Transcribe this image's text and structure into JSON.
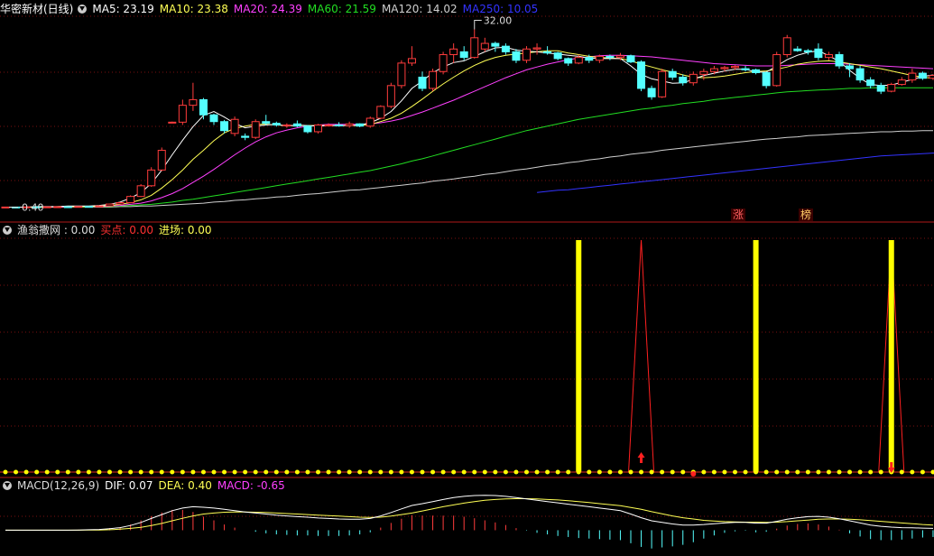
{
  "colors": {
    "bg": "#000000",
    "up": "#ff3c3c",
    "down": "#54ffff",
    "grid": "#7a1010",
    "ma5": "#ffffff",
    "ma10": "#ffff55",
    "ma20": "#ff40ff",
    "ma60": "#22dd22",
    "ma120": "#cfcfcf",
    "ma250": "#3333ff",
    "yellow": "#ffff00",
    "red": "#ff2020"
  },
  "header": {
    "title": "华密新材(日线)",
    "ma5": "MA5: 23.19",
    "ma10": "MA10: 23.38",
    "ma20": "MA20: 24.39",
    "ma60": "MA60: 21.59",
    "ma120": "MA120: 14.02",
    "ma250": "MA250: 10.05"
  },
  "panel2_header": {
    "name": "渔翁撒网 : 0.00",
    "buy": "买点: 0.00",
    "enter": "进场: 0.00"
  },
  "panel3_header": {
    "name": "MACD(12,26,9)",
    "dif": "DIF: 0.07",
    "dea": "DEA: 0.40",
    "macd": "MACD: -0.65"
  },
  "annotations": {
    "high": "32.00",
    "low": "0.40",
    "tag1": "涨",
    "tag2": "榜"
  },
  "chart_data": [
    {
      "type": "candlestick",
      "title": "华密新材(日线)",
      "ylim": [
        0,
        34
      ],
      "candles": [
        [
          0.4,
          0.45,
          0.38,
          0.42
        ],
        [
          0.42,
          0.44,
          0.4,
          0.41
        ],
        [
          0.41,
          0.46,
          0.4,
          0.45
        ],
        [
          0.45,
          0.48,
          0.43,
          0.44
        ],
        [
          0.44,
          0.47,
          0.42,
          0.46
        ],
        [
          0.46,
          0.5,
          0.44,
          0.48
        ],
        [
          0.48,
          0.52,
          0.46,
          0.47
        ],
        [
          0.47,
          0.55,
          0.46,
          0.53
        ],
        [
          0.53,
          0.58,
          0.5,
          0.52
        ],
        [
          0.52,
          0.65,
          0.5,
          0.62
        ],
        [
          0.62,
          1.0,
          0.6,
          0.95
        ],
        [
          0.95,
          1.3,
          0.9,
          1.2
        ],
        [
          1.2,
          2.5,
          1.1,
          2.3
        ],
        [
          2.3,
          4.5,
          2.2,
          4.2
        ],
        [
          4.2,
          7.5,
          4.0,
          7.0
        ],
        [
          7.0,
          11.0,
          6.8,
          10.5
        ],
        [
          15.4,
          15.6,
          15.3,
          15.5
        ],
        [
          15.5,
          19.5,
          15.0,
          18.5
        ],
        [
          18.5,
          22.5,
          17.5,
          19.5
        ],
        [
          19.5,
          19.8,
          16.0,
          16.8
        ],
        [
          16.8,
          17.0,
          15.0,
          15.6
        ],
        [
          15.6,
          15.9,
          13.5,
          14.0
        ],
        [
          13.5,
          16.5,
          13.0,
          16.0
        ],
        [
          13.0,
          13.5,
          12.3,
          12.8
        ],
        [
          12.8,
          16.0,
          12.5,
          15.6
        ],
        [
          15.6,
          16.8,
          15.0,
          15.3
        ],
        [
          15.3,
          15.6,
          14.7,
          15.0
        ],
        [
          15.0,
          15.3,
          14.5,
          15.0
        ],
        [
          15.2,
          15.8,
          14.6,
          14.8
        ],
        [
          14.8,
          15.0,
          13.5,
          13.8
        ],
        [
          13.8,
          15.2,
          13.5,
          15.0
        ],
        [
          15.0,
          15.3,
          14.8,
          15.0
        ],
        [
          15.0,
          15.5,
          14.7,
          14.9
        ],
        [
          14.9,
          15.6,
          14.5,
          15.2
        ],
        [
          15.2,
          15.3,
          14.6,
          14.8
        ],
        [
          14.8,
          16.5,
          14.5,
          16.2
        ],
        [
          16.2,
          18.5,
          16.0,
          18.3
        ],
        [
          18.3,
          22.5,
          18.0,
          22.0
        ],
        [
          22.0,
          26.5,
          21.5,
          26.0
        ],
        [
          26.0,
          29.0,
          25.5,
          26.8
        ],
        [
          23.5,
          24.5,
          21.0,
          21.5
        ],
        [
          21.5,
          25.0,
          21.0,
          24.5
        ],
        [
          24.5,
          28.0,
          24.0,
          27.5
        ],
        [
          27.5,
          29.5,
          26.0,
          28.5
        ],
        [
          28.0,
          29.0,
          26.5,
          27.0
        ],
        [
          27.0,
          32.0,
          26.8,
          30.5
        ],
        [
          28.5,
          30.5,
          28.0,
          29.5
        ],
        [
          29.5,
          29.8,
          28.0,
          29.0
        ],
        [
          29.0,
          29.5,
          27.5,
          28.0
        ],
        [
          28.0,
          28.5,
          26.0,
          26.5
        ],
        [
          26.5,
          29.0,
          26.0,
          28.5
        ],
        [
          28.5,
          29.5,
          27.5,
          28.7
        ],
        [
          28.0,
          29.0,
          27.5,
          27.8
        ],
        [
          27.8,
          28.0,
          26.5,
          26.8
        ],
        [
          26.8,
          27.0,
          25.5,
          26.0
        ],
        [
          26.0,
          27.5,
          25.8,
          27.0
        ],
        [
          27.0,
          27.5,
          26.0,
          26.5
        ],
        [
          26.5,
          27.5,
          26.0,
          27.2
        ],
        [
          27.2,
          27.5,
          26.5,
          27.0
        ],
        [
          27.0,
          27.8,
          26.5,
          27.3
        ],
        [
          27.3,
          27.5,
          26.0,
          26.2
        ],
        [
          26.2,
          26.5,
          21.0,
          21.5
        ],
        [
          21.5,
          22.0,
          19.5,
          20.0
        ],
        [
          20.0,
          25.0,
          19.8,
          24.5
        ],
        [
          24.5,
          25.0,
          23.0,
          23.5
        ],
        [
          23.5,
          24.0,
          22.0,
          22.5
        ],
        [
          22.5,
          24.5,
          22.0,
          24.0
        ],
        [
          24.0,
          25.0,
          23.0,
          24.5
        ],
        [
          24.5,
          25.5,
          24.0,
          25.0
        ],
        [
          25.0,
          25.5,
          24.5,
          25.2
        ],
        [
          25.2,
          25.6,
          24.8,
          25.4
        ],
        [
          25.0,
          25.5,
          24.5,
          24.8
        ],
        [
          24.8,
          25.0,
          24.0,
          24.3
        ],
        [
          24.3,
          24.5,
          21.5,
          22.0
        ],
        [
          22.0,
          28.0,
          21.8,
          27.5
        ],
        [
          27.5,
          31.0,
          27.0,
          30.5
        ],
        [
          28.5,
          29.0,
          28.0,
          28.2
        ],
        [
          28.2,
          28.5,
          27.5,
          28.0
        ],
        [
          28.5,
          29.5,
          26.5,
          27.0
        ],
        [
          27.0,
          28.0,
          26.5,
          27.5
        ],
        [
          27.5,
          28.0,
          25.0,
          25.5
        ],
        [
          25.5,
          26.0,
          23.5,
          25.0
        ],
        [
          25.0,
          25.5,
          22.5,
          23.0
        ],
        [
          23.0,
          23.5,
          21.5,
          22.0
        ],
        [
          22.0,
          22.5,
          20.5,
          21.0
        ],
        [
          21.0,
          22.5,
          20.8,
          22.2
        ],
        [
          22.2,
          23.5,
          22.0,
          23.0
        ],
        [
          23.0,
          25.0,
          22.5,
          24.2
        ],
        [
          24.2,
          24.5,
          23.0,
          23.3
        ],
        [
          23.3,
          24.0,
          23.0,
          23.8
        ],
        [
          23.8,
          24.8,
          23.5,
          24.5
        ]
      ],
      "ma": {
        "MA5": [
          0.4,
          0.4,
          0.4,
          0.5,
          0.5,
          0.5,
          0.6,
          0.6,
          0.6,
          0.7,
          0.9,
          1.3,
          2.0,
          3.0,
          4.6,
          7.0,
          9.7,
          12.3,
          14.7,
          16.7,
          17.4,
          16.4,
          15.3,
          14.5,
          14.8,
          15.0,
          15.1,
          14.8,
          15.0,
          14.9,
          14.8,
          14.9,
          14.9,
          14.9,
          15.0,
          15.4,
          16.2,
          17.4,
          19.3,
          21.5,
          22.8,
          24.3,
          25.3,
          26.1,
          26.4,
          27.2,
          28.0,
          28.7,
          28.8,
          28.3,
          28.1,
          28.0,
          27.8,
          27.6,
          27.4,
          27.2,
          26.9,
          26.8,
          26.8,
          26.8,
          25.5,
          24.0,
          23.2,
          22.8,
          22.4,
          22.5,
          23.1,
          23.8,
          24.2,
          24.6,
          24.9,
          24.9,
          24.4,
          24.4,
          25.5,
          26.6,
          27.4,
          27.9,
          28.2,
          27.3,
          26.3,
          24.7,
          23.3,
          22.2,
          22.0,
          22.1,
          22.6,
          23.1,
          23.6,
          23.9
        ],
        "MA10": [
          0.4,
          0.4,
          0.4,
          0.4,
          0.4,
          0.5,
          0.5,
          0.5,
          0.5,
          0.6,
          0.7,
          0.9,
          1.2,
          1.7,
          2.5,
          3.8,
          5.3,
          7.0,
          8.9,
          10.5,
          12.2,
          13.6,
          14.4,
          14.8,
          15.1,
          15.1,
          15.0,
          14.9,
          14.9,
          14.9,
          14.9,
          14.9,
          14.9,
          14.9,
          14.9,
          15.1,
          15.6,
          16.2,
          17.1,
          18.3,
          19.6,
          21.0,
          22.3,
          23.5,
          24.6,
          25.6,
          26.4,
          27.0,
          27.4,
          27.6,
          27.8,
          28.0,
          28.2,
          28.2,
          27.8,
          27.5,
          27.2,
          27.0,
          26.9,
          26.8,
          26.4,
          25.8,
          25.3,
          24.8,
          24.4,
          23.9,
          23.5,
          23.4,
          23.5,
          23.7,
          24.0,
          24.3,
          24.5,
          24.6,
          24.9,
          25.3,
          25.8,
          26.1,
          26.3,
          26.4,
          26.2,
          25.9,
          25.6,
          25.3,
          25.0,
          24.6,
          24.2,
          23.8,
          23.5,
          23.3
        ],
        "MA20": [
          0.4,
          0.4,
          0.4,
          0.4,
          0.4,
          0.4,
          0.4,
          0.5,
          0.5,
          0.5,
          0.6,
          0.7,
          0.9,
          1.1,
          1.5,
          2.1,
          2.8,
          3.7,
          4.8,
          5.9,
          7.1,
          8.4,
          9.7,
          10.9,
          12.0,
          12.9,
          13.6,
          14.1,
          14.5,
          14.8,
          15.0,
          15.1,
          15.1,
          15.1,
          15.1,
          15.2,
          15.4,
          15.7,
          16.1,
          16.7,
          17.3,
          18.0,
          18.7,
          19.4,
          20.2,
          21.0,
          21.8,
          22.6,
          23.4,
          24.1,
          24.8,
          25.3,
          25.8,
          26.2,
          26.6,
          26.9,
          27.1,
          27.3,
          27.4,
          27.4,
          27.3,
          27.2,
          27.1,
          26.9,
          26.7,
          26.5,
          26.3,
          26.1,
          25.9,
          25.8,
          25.7,
          25.6,
          25.5,
          25.5,
          25.5,
          25.6,
          25.7,
          25.8,
          25.9,
          25.9,
          25.9,
          25.8,
          25.7,
          25.6,
          25.5,
          25.4,
          25.3,
          25.2,
          25.1,
          25.0
        ],
        "MA60": [
          0.4,
          0.4,
          0.4,
          0.4,
          0.4,
          0.4,
          0.4,
          0.4,
          0.4,
          0.5,
          0.5,
          0.6,
          0.7,
          0.8,
          0.9,
          1.1,
          1.3,
          1.6,
          1.8,
          2.1,
          2.4,
          2.7,
          3.0,
          3.3,
          3.6,
          3.9,
          4.2,
          4.5,
          4.8,
          5.1,
          5.4,
          5.7,
          6.0,
          6.3,
          6.6,
          6.9,
          7.3,
          7.7,
          8.1,
          8.6,
          9.0,
          9.5,
          10.0,
          10.5,
          11.0,
          11.5,
          12.0,
          12.5,
          13.0,
          13.5,
          14.0,
          14.4,
          14.8,
          15.2,
          15.6,
          16.0,
          16.3,
          16.6,
          16.9,
          17.2,
          17.5,
          17.8,
          18.0,
          18.3,
          18.5,
          18.8,
          19.0,
          19.2,
          19.5,
          19.7,
          19.9,
          20.1,
          20.3,
          20.5,
          20.7,
          20.9,
          21.0,
          21.1,
          21.2,
          21.3,
          21.4,
          21.5,
          21.5,
          21.6,
          21.6,
          21.6,
          21.6,
          21.6,
          21.6,
          21.6
        ],
        "MA120": [
          0.4,
          0.4,
          0.4,
          0.4,
          0.4,
          0.4,
          0.4,
          0.4,
          0.4,
          0.4,
          0.4,
          0.5,
          0.5,
          0.6,
          0.6,
          0.7,
          0.8,
          0.9,
          1.0,
          1.1,
          1.3,
          1.4,
          1.6,
          1.7,
          1.9,
          2.0,
          2.2,
          2.3,
          2.5,
          2.7,
          2.8,
          3.0,
          3.2,
          3.4,
          3.5,
          3.7,
          3.9,
          4.1,
          4.3,
          4.5,
          4.7,
          5.0,
          5.2,
          5.4,
          5.7,
          5.9,
          6.2,
          6.4,
          6.7,
          7.0,
          7.2,
          7.5,
          7.8,
          8.0,
          8.3,
          8.5,
          8.8,
          9.0,
          9.3,
          9.5,
          9.8,
          10.0,
          10.2,
          10.5,
          10.7,
          10.9,
          11.1,
          11.3,
          11.5,
          11.7,
          11.9,
          12.1,
          12.3,
          12.5,
          12.6,
          12.8,
          12.9,
          13.1,
          13.2,
          13.3,
          13.4,
          13.5,
          13.6,
          13.7,
          13.8,
          13.8,
          13.9,
          13.9,
          14.0,
          14.0
        ],
        "MA250": {
          "start": 51,
          "values": [
            3.0,
            3.2,
            3.4,
            3.5,
            3.7,
            3.9,
            4.1,
            4.3,
            4.5,
            4.7,
            4.9,
            5.1,
            5.3,
            5.5,
            5.7,
            5.9,
            6.1,
            6.3,
            6.5,
            6.7,
            6.9,
            7.1,
            7.3,
            7.5,
            7.7,
            7.9,
            8.1,
            8.3,
            8.5,
            8.7,
            8.9,
            9.1,
            9.3,
            9.5,
            9.6,
            9.7,
            9.8,
            9.9,
            10.0,
            10.05
          ]
        }
      }
    },
    {
      "type": "bar",
      "title": "渔翁撒网",
      "ylim": [
        0,
        1
      ],
      "yellow_bars": [
        55,
        72,
        85
      ],
      "red_spikes": [
        61,
        85
      ],
      "arrow_up": 61,
      "arrow_down": 85,
      "red_dot": 66,
      "dots": 90
    },
    {
      "type": "line",
      "title": "MACD(12,26,9)",
      "ylim": [
        -0.85,
        1.4
      ],
      "dif": [
        0,
        0,
        0,
        0,
        0,
        0,
        0,
        0.01,
        0.02,
        0.03,
        0.06,
        0.1,
        0.18,
        0.3,
        0.45,
        0.6,
        0.75,
        0.85,
        0.9,
        0.88,
        0.85,
        0.8,
        0.75,
        0.7,
        0.66,
        0.62,
        0.58,
        0.55,
        0.52,
        0.5,
        0.47,
        0.45,
        0.43,
        0.42,
        0.42,
        0.45,
        0.55,
        0.68,
        0.82,
        0.95,
        1.02,
        1.1,
        1.18,
        1.25,
        1.3,
        1.33,
        1.34,
        1.33,
        1.3,
        1.25,
        1.2,
        1.15,
        1.1,
        1.05,
        1.0,
        0.95,
        0.9,
        0.85,
        0.8,
        0.75,
        0.62,
        0.48,
        0.36,
        0.3,
        0.24,
        0.2,
        0.2,
        0.22,
        0.25,
        0.28,
        0.3,
        0.3,
        0.27,
        0.27,
        0.34,
        0.42,
        0.48,
        0.52,
        0.53,
        0.5,
        0.44,
        0.36,
        0.28,
        0.2,
        0.15,
        0.12,
        0.1,
        0.09,
        0.08,
        0.07
      ],
      "dea": [
        0,
        0,
        0,
        0,
        0,
        0,
        0,
        0,
        0.01,
        0.01,
        0.02,
        0.04,
        0.07,
        0.11,
        0.18,
        0.26,
        0.36,
        0.46,
        0.55,
        0.62,
        0.66,
        0.69,
        0.7,
        0.7,
        0.69,
        0.68,
        0.66,
        0.64,
        0.62,
        0.6,
        0.58,
        0.56,
        0.54,
        0.52,
        0.5,
        0.49,
        0.5,
        0.54,
        0.6,
        0.66,
        0.74,
        0.82,
        0.9,
        0.97,
        1.04,
        1.1,
        1.15,
        1.18,
        1.2,
        1.21,
        1.21,
        1.2,
        1.18,
        1.16,
        1.13,
        1.1,
        1.06,
        1.02,
        0.98,
        0.94,
        0.87,
        0.8,
        0.71,
        0.63,
        0.55,
        0.48,
        0.43,
        0.38,
        0.35,
        0.33,
        0.32,
        0.31,
        0.31,
        0.3,
        0.31,
        0.33,
        0.36,
        0.39,
        0.42,
        0.43,
        0.43,
        0.42,
        0.4,
        0.37,
        0.34,
        0.31,
        0.28,
        0.25,
        0.22,
        0.2
      ]
    }
  ]
}
